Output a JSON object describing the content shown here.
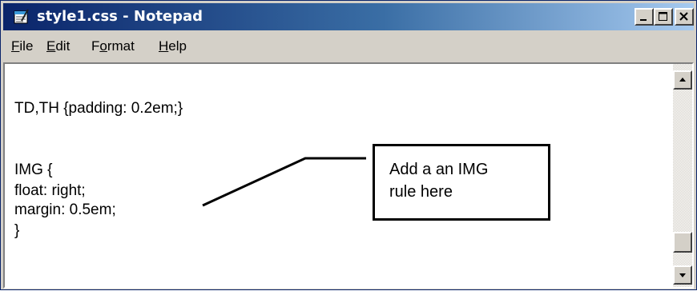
{
  "window": {
    "title": "style1.css - Notepad",
    "icon": "notepad-icon",
    "controls": {
      "minimize": "minimize-icon",
      "maximize": "maximize-icon",
      "close": "close-icon"
    }
  },
  "menu": [
    {
      "accel": "F",
      "rest": "ile"
    },
    {
      "accel": "E",
      "rest": "dit"
    },
    {
      "pre": "F",
      "accel": "o",
      "rest": "rmat"
    },
    {
      "accel": "H",
      "rest": "elp"
    }
  ],
  "editor": {
    "lines": [
      "TD,TH {padding: 0.2em;}",
      "IMG {",
      "float: right;",
      "margin: 0.5em;",
      "}"
    ]
  },
  "callout": {
    "text": "Add a an IMG\nrule here"
  },
  "colors": {
    "titlebar_start": "#0a246a",
    "titlebar_end": "#a6caf0",
    "face": "#d4d0c8"
  }
}
